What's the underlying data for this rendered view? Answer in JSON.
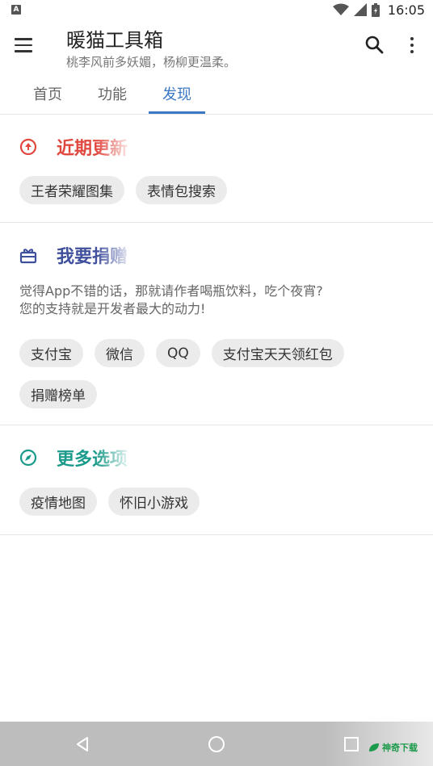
{
  "status_bar": {
    "notification_letter": "A",
    "time": "16:05",
    "icons": [
      "wifi-icon",
      "signal-icon",
      "battery-icon"
    ]
  },
  "app_bar": {
    "title": "暖猫工具箱",
    "subtitle": "桃李风前多妖媚，杨柳更温柔。",
    "icons": [
      "menu-icon",
      "search-icon",
      "more-vert-icon"
    ]
  },
  "tabs": [
    {
      "label": "首页",
      "active": false
    },
    {
      "label": "功能",
      "active": false
    },
    {
      "label": "发现",
      "active": true
    }
  ],
  "sections": {
    "recent": {
      "icon": "arrow-up-circle-icon",
      "title": "近期更新",
      "color": "#e0483f",
      "chips": [
        "王者荣耀图集",
        "表情包搜索"
      ]
    },
    "donate": {
      "icon": "gift-icon",
      "title": "我要捐赠",
      "color": "#3e4f9c",
      "desc_line1": "觉得App不错的话，那就请作者喝瓶饮料，吃个夜宵?",
      "desc_line2": "您的支持就是开发者最大的动力!",
      "chips": [
        "支付宝",
        "微信",
        "QQ",
        "支付宝天天领红包",
        "捐赠榜单"
      ]
    },
    "more": {
      "icon": "compass-icon",
      "title": "更多选项",
      "color": "#1a9a8a",
      "chips": [
        "疫情地图",
        "怀旧小游戏"
      ]
    }
  },
  "nav_bar": {
    "icons": [
      "back-icon",
      "home-icon",
      "recents-icon"
    ],
    "watermark": "神奇下载"
  },
  "colors": {
    "accent": "#3b78c4",
    "chip_bg": "#ebebeb"
  }
}
